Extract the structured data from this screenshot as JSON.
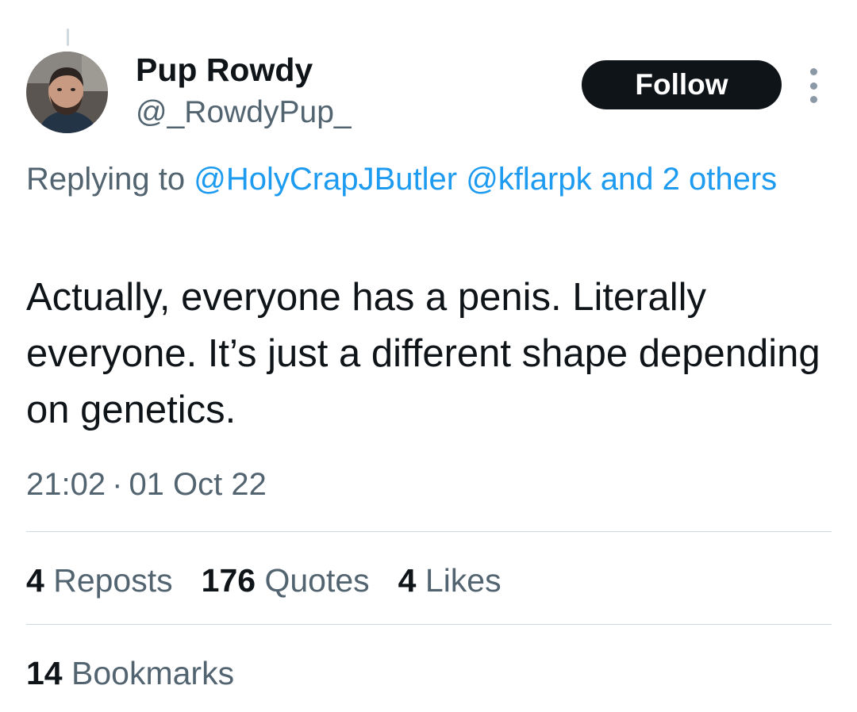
{
  "author": {
    "display_name": "Pup Rowdy",
    "handle": "@_RowdyPup_"
  },
  "follow_label": "Follow",
  "reply_context": {
    "prefix": "Replying to",
    "mention_1": "@HolyCrapJButler",
    "mention_2": "@kflarpk",
    "others": "and 2 others"
  },
  "tweet": {
    "text": "Actually, everyone has a penis. Literally everyone. It’s just a different shape depending on genetics."
  },
  "timestamp": {
    "time": "21:02",
    "separator": "·",
    "date": "01 Oct 22"
  },
  "stats": {
    "reposts": {
      "count": "4",
      "label": "Reposts"
    },
    "quotes": {
      "count": "176",
      "label": "Quotes"
    },
    "likes": {
      "count": "4",
      "label": "Likes"
    },
    "bookmarks": {
      "count": "14",
      "label": "Bookmarks"
    }
  },
  "icons": {
    "more": "more-dots-vertical-icon"
  },
  "colors": {
    "link": "#1d9bf0",
    "secondary_text": "#536471",
    "primary_text": "#0f1419",
    "follow_bg": "#0f1419",
    "divider": "#cfd9de"
  }
}
